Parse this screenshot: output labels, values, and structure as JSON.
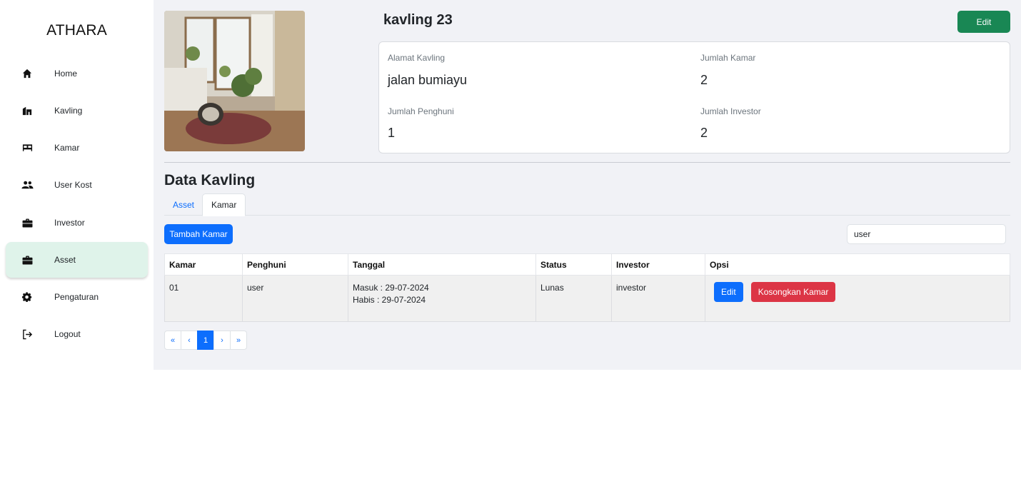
{
  "app": {
    "brand": "ATHARA"
  },
  "sidebar": {
    "items": [
      {
        "label": "Home",
        "icon": "home-icon"
      },
      {
        "label": "Kavling",
        "icon": "kavling-icon"
      },
      {
        "label": "Kamar",
        "icon": "bed-icon"
      },
      {
        "label": "User Kost",
        "icon": "users-icon"
      },
      {
        "label": "Investor",
        "icon": "briefcase-icon"
      },
      {
        "label": "Asset",
        "icon": "briefcase-icon",
        "active": true
      },
      {
        "label": "Pengaturan",
        "icon": "gear-icon"
      },
      {
        "label": "Logout",
        "icon": "logout-icon"
      }
    ]
  },
  "header": {
    "title": "kavling 23",
    "edit_label": "Edit"
  },
  "info": {
    "alamat_label": "Alamat Kavling",
    "alamat_value": "jalan bumiayu",
    "kamar_label": "Jumlah Kamar",
    "kamar_value": "2",
    "penghuni_label": "Jumlah Penghuni",
    "penghuni_value": "1",
    "investor_label": "Jumlah Investor",
    "investor_value": "2"
  },
  "section": {
    "title": "Data Kavling"
  },
  "tabs": {
    "asset": "Asset",
    "kamar": "Kamar",
    "active": "Kamar"
  },
  "actions": {
    "add_label": "Tambah Kamar"
  },
  "search": {
    "value": "user"
  },
  "table": {
    "headers": [
      "Kamar",
      "Penghuni",
      "Tanggal",
      "Status",
      "Investor",
      "Opsi"
    ],
    "rows": [
      {
        "kamar": "01",
        "penghuni": "user",
        "masuk": "Masuk : 29-07-2024",
        "habis": "Habis : 29-07-2024",
        "status": "Lunas",
        "investor": "investor",
        "edit_label": "Edit",
        "empty_label": "Kosongkan Kamar"
      }
    ]
  },
  "pagination": {
    "first": "«",
    "prev": "‹",
    "current": "1",
    "next": "›",
    "last": "»"
  },
  "colors": {
    "accent": "#0d6efd",
    "success": "#198754",
    "danger": "#dc3545",
    "active_nav": "#dff3ea",
    "main_bg": "#f1f2f6"
  }
}
